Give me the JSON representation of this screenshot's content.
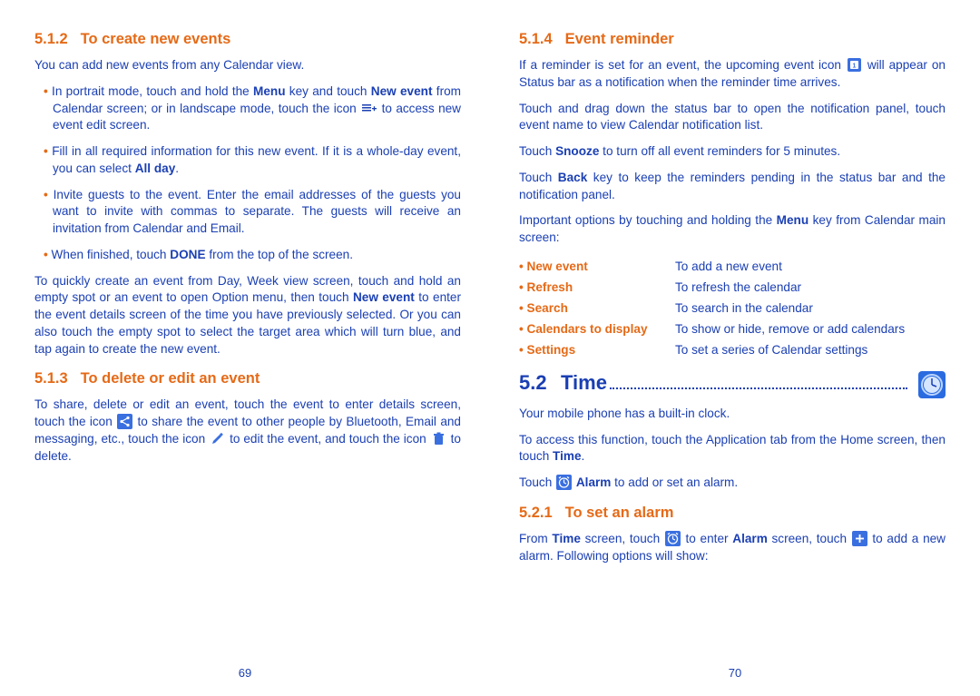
{
  "left": {
    "sec512": {
      "num": "5.1.2",
      "title": "To create new events",
      "intro": "You can add new events from any Calendar view.",
      "li1a": "In portrait mode, touch and hold the ",
      "li1b": "Menu",
      "li1c": " key and touch ",
      "li1d": "New event",
      "li1e": " from Calendar screen; or in landscape mode, touch the icon ",
      "li1f": " to access new event edit screen.",
      "li2a": "Fill in all required information for this new event. If it is a whole-day event, you can select ",
      "li2b": "All day",
      "li2c": ".",
      "li3": "Invite guests to the event. Enter the email addresses of the guests you want to invite with commas to separate. The guests will receive an invitation from Calendar and Email.",
      "li4a": "When finished, touch ",
      "li4b": "DONE",
      "li4c": " from the top of the screen.",
      "tail1": "To quickly create an event from Day, Week view screen, touch and hold an empty spot or an event to open Option menu, then touch ",
      "tail1b": "New event",
      "tail1c": " to enter the event details screen of the time you have previously selected. Or you can also touch the empty spot to select the target area which will turn blue, and tap again to create the new event."
    },
    "sec513": {
      "num": "5.1.3",
      "title": "To delete or edit an event",
      "p1a": "To share, delete or edit an event, touch the event to enter details screen, touch the icon ",
      "p1b": " to share the event to other people by Bluetooth, Email and messaging, etc., touch  the icon ",
      "p1c": "  to edit the event, and touch the icon ",
      "p1d": "  to delete."
    },
    "pagenum": "69"
  },
  "right": {
    "sec514": {
      "num": "5.1.4",
      "title": "Event reminder",
      "p1a": "If a reminder is set for an event, the upcoming event icon ",
      "p1b": " will appear on Status bar as a notification when the reminder time arrives.",
      "p2": "Touch and drag down the status bar to open the notification panel, touch event name to view Calendar notification list.",
      "p3a": "Touch ",
      "p3b": "Snooze",
      "p3c": " to turn off all event reminders for 5 minutes.",
      "p4a": "Touch ",
      "p4b": "Back",
      "p4c": " key to keep the reminders pending in the status bar and the notification panel.",
      "p5a": "Important options by touching and holding the ",
      "p5b": "Menu",
      "p5c": " key from Calendar main screen:",
      "menu": [
        {
          "label": "New event",
          "desc": "To add a new event"
        },
        {
          "label": "Refresh",
          "desc": "To refresh the calendar"
        },
        {
          "label": "Search",
          "desc": "To search in the calendar"
        },
        {
          "label": "Calendars to display",
          "desc": "To show or hide, remove or add calendars"
        },
        {
          "label": "Settings",
          "desc": "To set a series of Calendar settings"
        }
      ]
    },
    "sec52": {
      "num": "5.2",
      "title": "Time",
      "p1": "Your mobile phone has a built-in clock.",
      "p2a": "To access this function, touch the Application tab from the Home screen, then touch ",
      "p2b": "Time",
      "p2c": ".",
      "p3a": "Touch ",
      "p3b": "Alarm",
      "p3c": " to add or set an alarm."
    },
    "sec521": {
      "num": "5.2.1",
      "title": "To set an alarm",
      "p1a": "From ",
      "p1b": "Time",
      "p1c": " screen, touch ",
      "p1d": " to enter ",
      "p1e": "Alarm",
      "p1f": " screen, touch ",
      "p1g": " to add a new alarm. Following options will show:"
    },
    "pagenum": "70"
  }
}
